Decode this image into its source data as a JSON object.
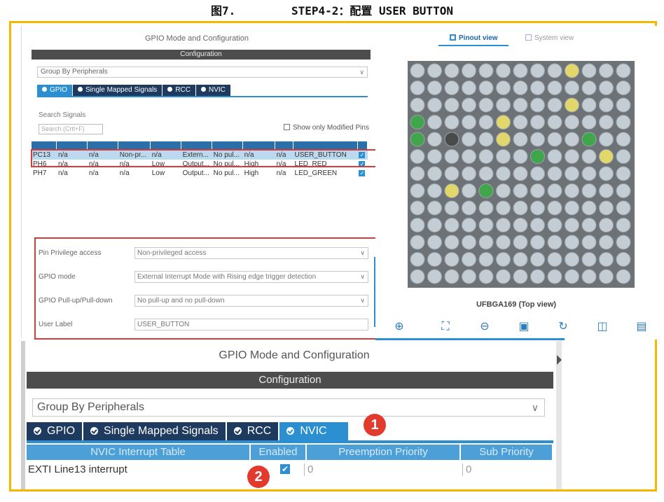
{
  "caption": {
    "figure": "图7.",
    "title": "STEP4-2：配置 USER BUTTON"
  },
  "top_panel": {
    "title": "GPIO Mode and Configuration",
    "config_bar": "Configuration",
    "group_by": "Group By Peripherals",
    "tabs": [
      {
        "label": "GPIO",
        "active": true
      },
      {
        "label": "Single Mapped Signals",
        "active": false
      },
      {
        "label": "RCC",
        "active": false
      },
      {
        "label": "NVIC",
        "active": false
      }
    ],
    "search_label": "Search Signals",
    "search_placeholder": "Search (Crtl+F)",
    "show_modified": "Show only Modified Pins",
    "rows": [
      [
        "PC13",
        "n/a",
        "n/a",
        "Non-pr...",
        "n/a",
        "Extern...",
        "No pul...",
        "n/a",
        "n/a",
        "USER_BUTTON"
      ],
      [
        "PH6",
        "n/a",
        "n/a",
        "n/a",
        "Low",
        "Output...",
        "No pul...",
        "High",
        "n/a",
        "LED_RED"
      ],
      [
        "PH7",
        "n/a",
        "n/a",
        "n/a",
        "Low",
        "Output...",
        "No pul...",
        "High",
        "n/a",
        "LED_GREEN"
      ]
    ],
    "props": [
      {
        "label": "Pin Privilege access",
        "value": "Non-privileged access",
        "dropdown": true
      },
      {
        "label": "GPIO mode",
        "value": "External Interrupt Mode with Rising edge trigger detection",
        "dropdown": true
      },
      {
        "label": "GPIO Pull-up/Pull-down",
        "value": "No pull-up and no pull-down",
        "dropdown": true
      },
      {
        "label": "User Label",
        "value": "USER_BUTTON",
        "dropdown": false
      }
    ]
  },
  "right_panel": {
    "pinout_view": "Pinout view",
    "system_view": "System view",
    "chip_label": "UFBGA169 (Top view)",
    "colors": {
      "default_pin": "#c4ccd4",
      "green_pin": "#3fa64b",
      "yellow_pin": "#e2d76a",
      "dark_pin": "#4a4a4a",
      "chip_body": "#6d7276"
    }
  },
  "bottom_panel": {
    "title": "GPIO Mode and Configuration",
    "config_bar": "Configuration",
    "group_by": "Group By Peripherals",
    "tabs": [
      {
        "label": "GPIO",
        "active": false
      },
      {
        "label": "Single Mapped Signals",
        "active": false
      },
      {
        "label": "RCC",
        "active": false
      },
      {
        "label": "NVIC",
        "active": true
      }
    ],
    "columns": [
      "NVIC Interrupt Table",
      "Enabled",
      "Preemption Priority",
      "Sub Priority"
    ],
    "row": {
      "name": "EXTI Line13 interrupt",
      "enabled": "✔",
      "preemption": "0",
      "sub": "0"
    }
  },
  "badges": [
    "1",
    "2"
  ]
}
